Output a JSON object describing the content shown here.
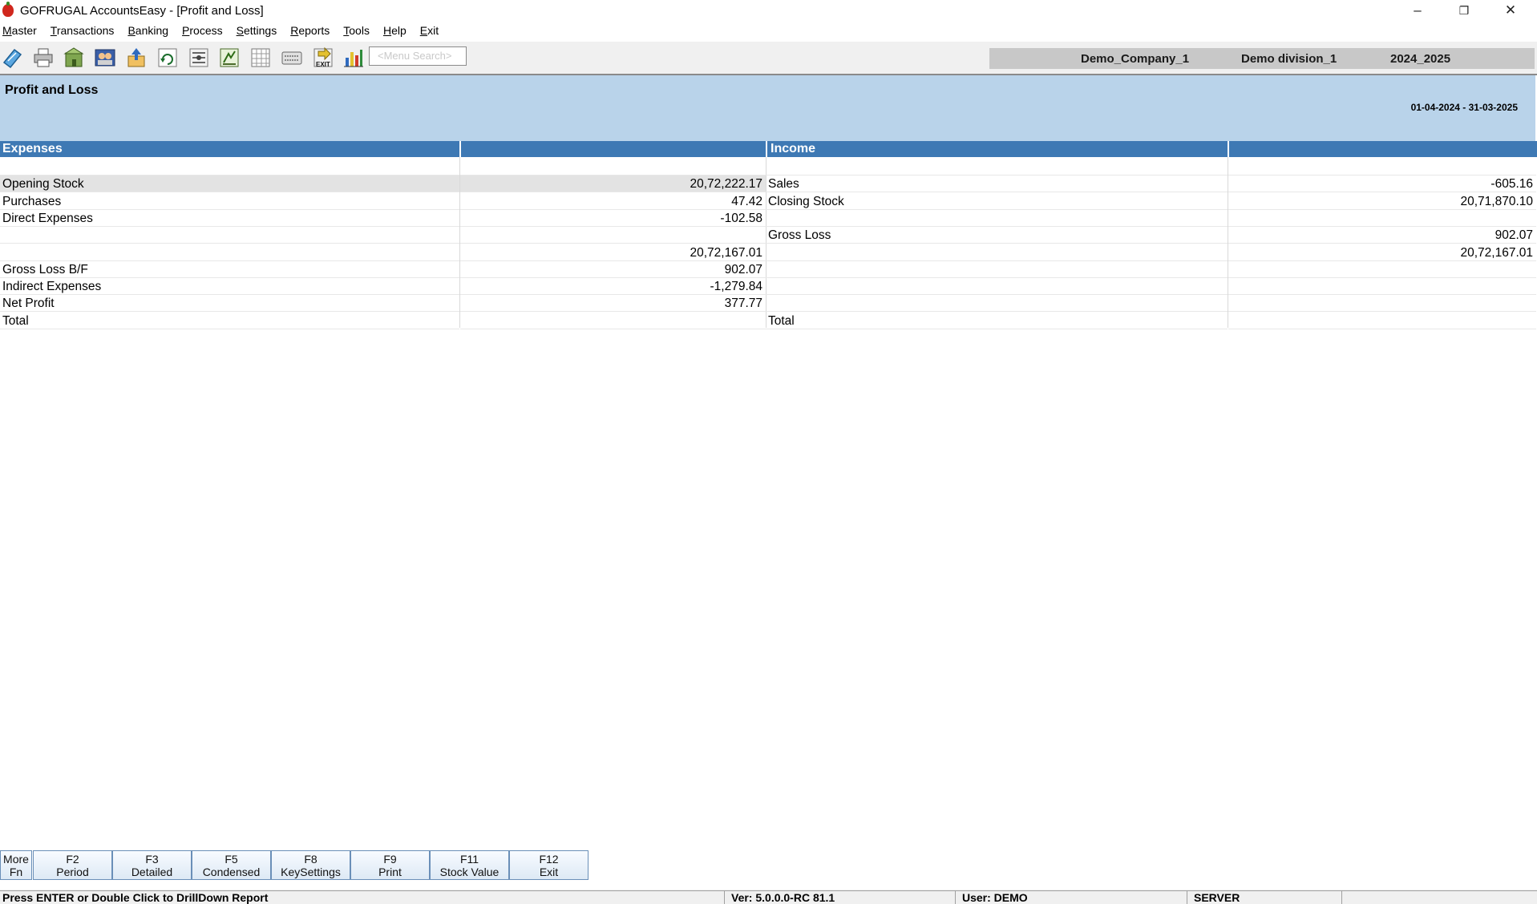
{
  "window": {
    "title": "GOFRUGAL AccountsEasy - [Profit and Loss]",
    "controls": {
      "minimize": "–",
      "restore": "❐",
      "close": "✕"
    }
  },
  "menubar": {
    "items": [
      {
        "label": "Master"
      },
      {
        "label": "Transactions"
      },
      {
        "label": "Banking"
      },
      {
        "label": "Process"
      },
      {
        "label": "Settings"
      },
      {
        "label": "Reports"
      },
      {
        "label": "Tools"
      },
      {
        "label": "Help"
      },
      {
        "label": "Exit"
      }
    ]
  },
  "toolbar": {
    "icons": [
      "pencil-ruler-icon",
      "printer-icon",
      "building-icon",
      "people-icon",
      "export-icon",
      "refresh-icon",
      "network-icon",
      "calculator-icon",
      "grid-icon",
      "keyboard-icon",
      "exit-icon",
      "bar-chart-icon"
    ],
    "exit_icon_text": "EXIT",
    "search_placeholder": "<Menu Search>",
    "company": "Demo_Company_1",
    "division": "Demo division_1",
    "year": "2024_2025"
  },
  "report": {
    "title": "Profit and Loss",
    "period": "01-04-2024 - 31-03-2025",
    "expenses_header": "Expenses",
    "income_header": "Income",
    "expenses": [
      {
        "label": "",
        "amount": ""
      },
      {
        "label": "Opening Stock",
        "amount": "20,72,222.17"
      },
      {
        "label": "Purchases",
        "amount": "47.42"
      },
      {
        "label": "Direct Expenses",
        "amount": "-102.58"
      },
      {
        "label": "",
        "amount": ""
      },
      {
        "label": "",
        "amount": "20,72,167.01"
      },
      {
        "label": "Gross Loss B/F",
        "amount": "902.07"
      },
      {
        "label": "Indirect Expenses",
        "amount": "-1,279.84"
      },
      {
        "label": "Net Profit",
        "amount": "377.77"
      },
      {
        "label": "Total",
        "amount": ""
      }
    ],
    "income": [
      {
        "label": "",
        "amount": ""
      },
      {
        "label": "Sales",
        "amount": "-605.16"
      },
      {
        "label": "Closing Stock",
        "amount": "20,71,870.10"
      },
      {
        "label": "",
        "amount": ""
      },
      {
        "label": "Gross Loss",
        "amount": "902.07"
      },
      {
        "label": "",
        "amount": "20,72,167.01"
      },
      {
        "label": "",
        "amount": ""
      },
      {
        "label": "",
        "amount": ""
      },
      {
        "label": "",
        "amount": ""
      },
      {
        "label": "Total",
        "amount": ""
      }
    ]
  },
  "function_keys": [
    {
      "key": "More",
      "label": "Fn"
    },
    {
      "key": "F2",
      "label": "Period"
    },
    {
      "key": "F3",
      "label": "Detailed"
    },
    {
      "key": "F5",
      "label": "Condensed"
    },
    {
      "key": "F8",
      "label": "KeySettings"
    },
    {
      "key": "F9",
      "label": "Print"
    },
    {
      "key": "F11",
      "label": "Stock Value"
    },
    {
      "key": "F12",
      "label": "Exit"
    }
  ],
  "status": {
    "hint": "Press ENTER or Double Click to DrillDown Report",
    "version": "Ver: 5.0.0.0-RC 81.1",
    "user": "User: DEMO",
    "server": "SERVER",
    "extra": ""
  }
}
